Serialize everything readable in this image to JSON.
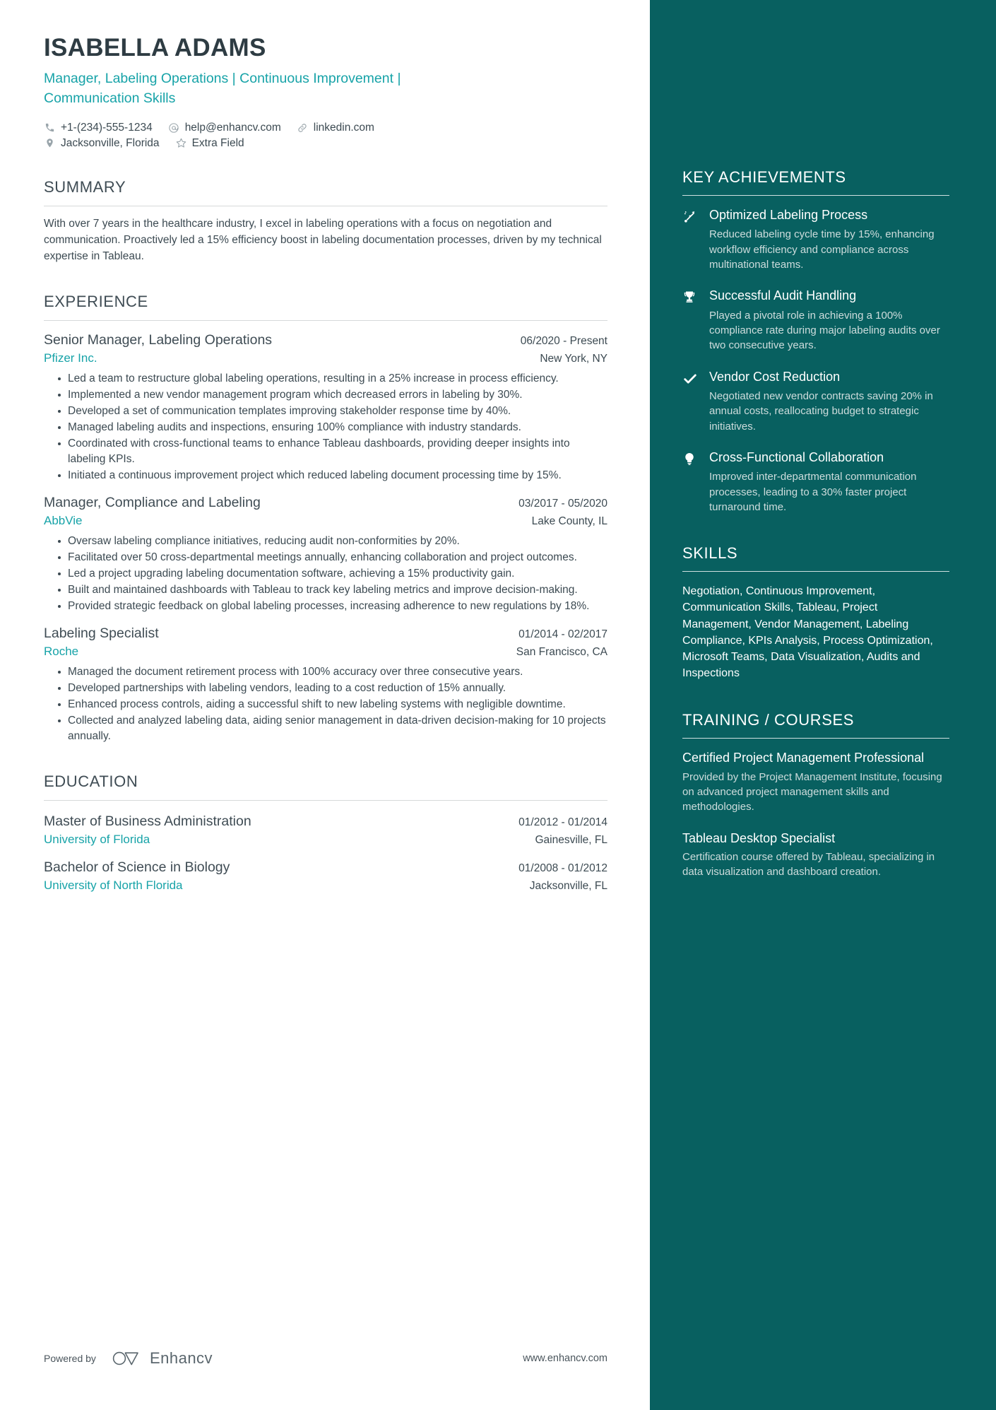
{
  "header": {
    "name": "ISABELLA ADAMS",
    "headline": "Manager, Labeling Operations | Continuous Improvement | Communication Skills",
    "contacts": [
      {
        "icon": "phone-icon",
        "text": "+1-(234)-555-1234"
      },
      {
        "icon": "email-icon",
        "text": "help@enhancv.com"
      },
      {
        "icon": "link-icon",
        "text": "linkedin.com"
      },
      {
        "icon": "location-icon",
        "text": "Jacksonville, Florida"
      },
      {
        "icon": "star-icon",
        "text": "Extra Field"
      }
    ]
  },
  "summary": {
    "title": "SUMMARY",
    "text": "With over 7 years in the healthcare industry, I excel in labeling operations with a focus on negotiation and communication. Proactively led a 15% efficiency boost in labeling documentation processes, driven by my technical expertise in Tableau."
  },
  "experience": {
    "title": "EXPERIENCE",
    "entries": [
      {
        "role": "Senior Manager, Labeling Operations",
        "date": "06/2020 - Present",
        "company": "Pfizer Inc.",
        "location": "New York, NY",
        "bullets": [
          "Led a team to restructure global labeling operations, resulting in a 25% increase in process efficiency.",
          "Implemented a new vendor management program which decreased errors in labeling by 30%.",
          "Developed a set of communication templates improving stakeholder response time by 40%.",
          "Managed labeling audits and inspections, ensuring 100% compliance with industry standards.",
          "Coordinated with cross-functional teams to enhance Tableau dashboards, providing deeper insights into labeling KPIs.",
          "Initiated a continuous improvement project which reduced labeling document processing time by 15%."
        ]
      },
      {
        "role": "Manager, Compliance and Labeling",
        "date": "03/2017 - 05/2020",
        "company": "AbbVie",
        "location": "Lake County, IL",
        "bullets": [
          "Oversaw labeling compliance initiatives, reducing audit non-conformities by 20%.",
          "Facilitated over 50 cross-departmental meetings annually, enhancing collaboration and project outcomes.",
          "Led a project upgrading labeling documentation software, achieving a 15% productivity gain.",
          "Built and maintained dashboards with Tableau to track key labeling metrics and improve decision-making.",
          "Provided strategic feedback on global labeling processes, increasing adherence to new regulations by 18%."
        ]
      },
      {
        "role": "Labeling Specialist",
        "date": "01/2014 - 02/2017",
        "company": "Roche",
        "location": "San Francisco, CA",
        "bullets": [
          "Managed the document retirement process with 100% accuracy over three consecutive years.",
          "Developed partnerships with labeling vendors, leading to a cost reduction of 15% annually.",
          "Enhanced process controls, aiding a successful shift to new labeling systems with negligible downtime.",
          "Collected and analyzed labeling data, aiding senior management in data-driven decision-making for 10 projects annually."
        ]
      }
    ]
  },
  "education": {
    "title": "EDUCATION",
    "entries": [
      {
        "degree": "Master of Business Administration",
        "date": "01/2012 - 01/2014",
        "school": "University of Florida",
        "location": "Gainesville, FL"
      },
      {
        "degree": "Bachelor of Science in Biology",
        "date": "01/2008 - 01/2012",
        "school": "University of North Florida",
        "location": "Jacksonville, FL"
      }
    ]
  },
  "key_achievements": {
    "title": "KEY ACHIEVEMENTS",
    "items": [
      {
        "icon": "sparkle-arrow-icon",
        "title": "Optimized Labeling Process",
        "description": "Reduced labeling cycle time by 15%, enhancing workflow efficiency and compliance across multinational teams."
      },
      {
        "icon": "trophy-icon",
        "title": "Successful Audit Handling",
        "description": "Played a pivotal role in achieving a 100% compliance rate during major labeling audits over two consecutive years."
      },
      {
        "icon": "check-icon",
        "title": "Vendor Cost Reduction",
        "description": "Negotiated new vendor contracts saving 20% in annual costs, reallocating budget to strategic initiatives."
      },
      {
        "icon": "lightbulb-icon",
        "title": "Cross-Functional Collaboration",
        "description": "Improved inter-departmental communication processes, leading to a 30% faster project turnaround time."
      }
    ]
  },
  "skills": {
    "title": "SKILLS",
    "text": "Negotiation, Continuous Improvement, Communication Skills, Tableau, Project Management, Vendor Management, Labeling Compliance, KPIs Analysis, Process Optimization, Microsoft Teams, Data Visualization, Audits and Inspections"
  },
  "training": {
    "title": "TRAINING / COURSES",
    "items": [
      {
        "title": "Certified Project Management Professional",
        "description": "Provided by the Project Management Institute, focusing on advanced project management skills and methodologies."
      },
      {
        "title": "Tableau Desktop Specialist",
        "description": "Certification course offered by Tableau, specializing in data visualization and dashboard creation."
      }
    ]
  },
  "footer": {
    "powered_by": "Powered by",
    "brand": "Enhancv",
    "url": "www.enhancv.com"
  },
  "colors": {
    "accent_teal": "#17a3a8",
    "sidebar_bg": "#086060",
    "text_dark": "#3c4a52"
  }
}
